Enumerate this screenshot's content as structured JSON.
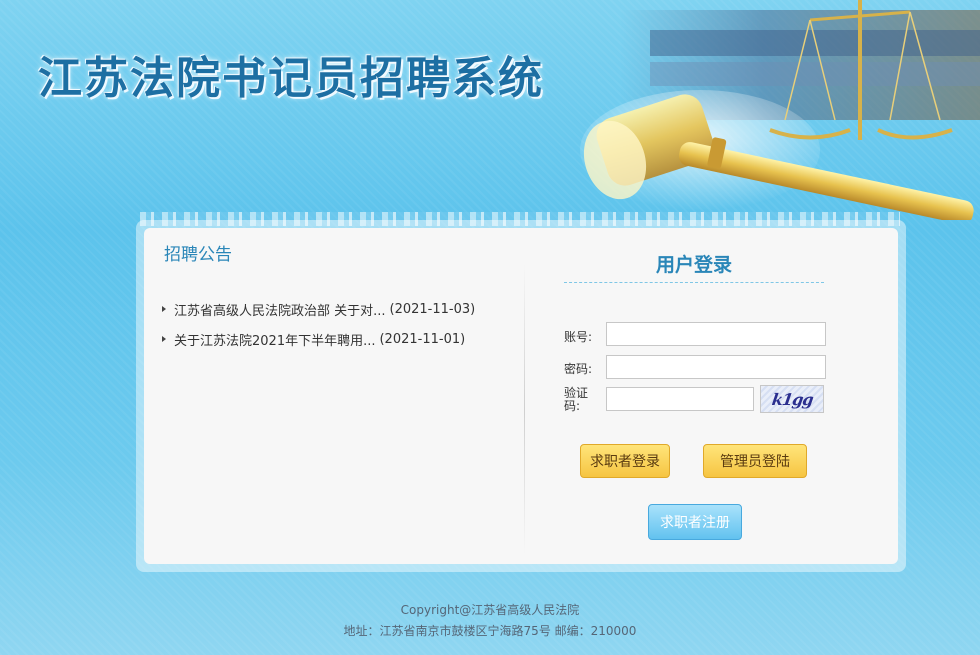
{
  "site": {
    "title": "江苏法院书记员招聘系统"
  },
  "notices": {
    "heading": "招聘公告",
    "items": [
      {
        "title": "江苏省高级人民法院政治部 关于对...",
        "date": "(2021-11-03)"
      },
      {
        "title": "关于江苏法院2021年下半年聘用...",
        "date": "(2021-11-01)"
      }
    ]
  },
  "login": {
    "title": "用户登录",
    "account_label": "账号:",
    "password_label": "密码:",
    "captcha_label": "验证码:",
    "account_value": "",
    "password_value": "",
    "captcha_value": "",
    "captcha_image_text": "k1gg",
    "seeker_login_button": "求职者登录",
    "admin_login_button": "管理员登陆",
    "register_button": "求职者注册"
  },
  "footer": {
    "copyright": "Copyright@江苏省高级人民法院",
    "address": "地址：江苏省南京市鼓楼区宁海路75号 邮编：210000"
  },
  "colors": {
    "background": "#5cc3ec",
    "title_blue": "#1d6fa3",
    "heading_blue": "#2a86b8",
    "button_yellow": "#f6c542",
    "button_blue": "#62c2ef"
  }
}
